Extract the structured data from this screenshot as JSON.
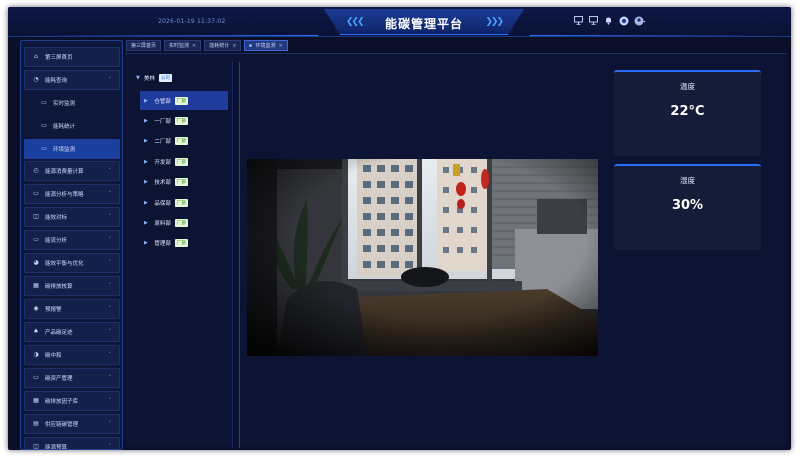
{
  "header": {
    "datetime": "2026-01-19 11:37:02",
    "title": "能碳管理平台",
    "chevrons_left": "❮❮❮",
    "chevrons_right": "❯❯❯",
    "icons": [
      "monitor-icon",
      "monitor-icon",
      "bell-icon",
      "help-icon",
      "avatar"
    ]
  },
  "sidebar": {
    "items": [
      {
        "label": "第三屏首页",
        "icon": "home-icon",
        "type": "top"
      },
      {
        "label": "能耗查询",
        "icon": "search-icon",
        "type": "top",
        "arrow": "˄"
      },
      {
        "label": "实时监测",
        "icon": "monitor-icon",
        "type": "sub"
      },
      {
        "label": "能耗统计",
        "icon": "monitor-icon",
        "type": "sub"
      },
      {
        "label": "环境监测",
        "icon": "monitor-icon",
        "type": "sub-active"
      },
      {
        "label": "能源消费量计算",
        "icon": "chart-icon",
        "type": "top",
        "arrow": "˅"
      },
      {
        "label": "能源分析与策略",
        "icon": "monitor-icon",
        "type": "top",
        "arrow": "˅"
      },
      {
        "label": "能效对标",
        "icon": "target-icon",
        "type": "top",
        "arrow": "˅"
      },
      {
        "label": "能流分析",
        "icon": "monitor-icon",
        "type": "top",
        "arrow": "˅"
      },
      {
        "label": "能效平衡与优化",
        "icon": "balance-icon",
        "type": "top",
        "arrow": "˅"
      },
      {
        "label": "碳排放核算",
        "icon": "grid-icon",
        "type": "top",
        "arrow": "˅"
      },
      {
        "label": "预报警",
        "icon": "alarm-icon",
        "type": "top",
        "arrow": "˅"
      },
      {
        "label": "产品碳足迹",
        "icon": "footprint-icon",
        "type": "top",
        "arrow": "˅"
      },
      {
        "label": "碳中和",
        "icon": "leaf-icon",
        "type": "top",
        "arrow": "˅"
      },
      {
        "label": "碳资产管理",
        "icon": "monitor-icon",
        "type": "top",
        "arrow": "˅"
      },
      {
        "label": "碳排放因子库",
        "icon": "grid-icon",
        "type": "top",
        "arrow": "˅"
      },
      {
        "label": "供应链碳管理",
        "icon": "chain-icon",
        "type": "top",
        "arrow": "˅"
      },
      {
        "label": "能源预算",
        "icon": "budget-icon",
        "type": "top",
        "arrow": "˅"
      }
    ]
  },
  "tabs": [
    {
      "label": "第三屏首页",
      "closable": false,
      "active": false
    },
    {
      "label": "实时监测",
      "closable": true,
      "active": false
    },
    {
      "label": "能耗统计",
      "closable": true,
      "active": false
    },
    {
      "label": "环境监测",
      "closable": true,
      "active": true
    }
  ],
  "tab_close": "×",
  "tree": {
    "root": {
      "label": "美林",
      "tag": "公司"
    },
    "nodes": [
      {
        "label": "仓管部",
        "tag": "厂部",
        "selected": true
      },
      {
        "label": "一厂部",
        "tag": "厂部"
      },
      {
        "label": "二厂部",
        "tag": "厂部"
      },
      {
        "label": "开发部",
        "tag": "厂部"
      },
      {
        "label": "技术部",
        "tag": "厂部"
      },
      {
        "label": "品保部",
        "tag": "厂部"
      },
      {
        "label": "原料部",
        "tag": "厂部"
      },
      {
        "label": "管理部",
        "tag": "厂部"
      }
    ]
  },
  "camera_feed": {
    "icon": "camera-feed-image"
  },
  "cards": [
    {
      "label": "温度",
      "value": "22°C"
    },
    {
      "label": "湿度",
      "value": "30%"
    }
  ],
  "colors": {
    "accent": "#2f6dff",
    "background": "#0b1028",
    "selected": "#1f3c9c",
    "tag_company_bg": "#dff0ff",
    "tag_factory_bg": "#e6f7d9"
  }
}
